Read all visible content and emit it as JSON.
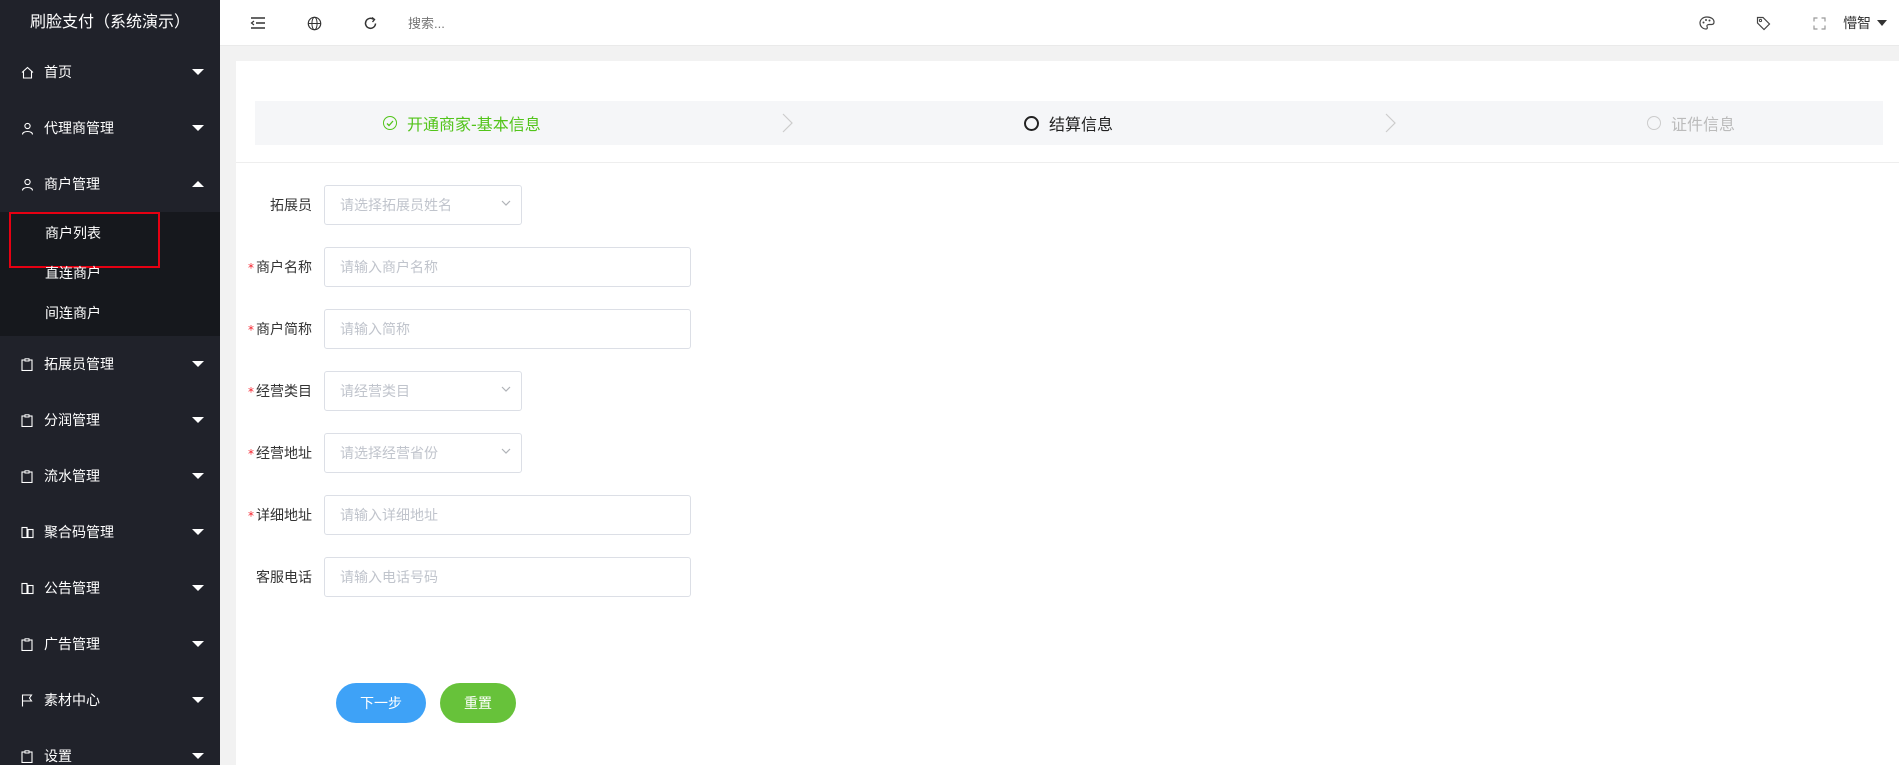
{
  "brand": "刷脸支付（系统演示）",
  "menu": {
    "home": "首页",
    "agent": "代理商管理",
    "merchant": "商户管理",
    "merchant_sub": [
      "商户列表",
      "直连商户",
      "间连商户"
    ],
    "promoter": "拓展员管理",
    "profit": "分润管理",
    "flow": "流水管理",
    "qrcode": "聚合码管理",
    "notice": "公告管理",
    "ads": "广告管理",
    "material": "素材中心",
    "settings": "设置"
  },
  "topbar": {
    "search_placeholder": "搜索...",
    "user": "懵智"
  },
  "steps": {
    "s1": "开通商家-基本信息",
    "s2": "结算信息",
    "s3": "证件信息"
  },
  "form": {
    "promoter_label": "拓展员",
    "promoter_ph": "请选择拓展员姓名",
    "name_label": "商户名称",
    "name_ph": "请输入商户名称",
    "short_label": "商户简称",
    "short_ph": "请输入简称",
    "category_label": "经营类目",
    "category_ph": "请经营类目",
    "addr_label": "经营地址",
    "addr_ph": "请选择经营省份",
    "detail_label": "详细地址",
    "detail_ph": "请输入详细地址",
    "phone_label": "客服电话",
    "phone_ph": "请输入电话号码",
    "required_mark": "*"
  },
  "buttons": {
    "next": "下一步",
    "reset": "重置"
  },
  "colors": {
    "sidebar_bg": "#20222a",
    "step_done": "#52c41a",
    "btn_next": "#3ea2f7",
    "btn_reset": "#67c23a",
    "highlight_box": "#e60012"
  }
}
